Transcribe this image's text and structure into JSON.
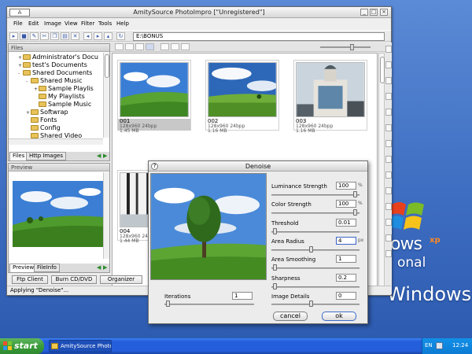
{
  "window": {
    "title": "AmitySource PhotoImpro [\"Unregistered\"]",
    "app_icon_label": "A",
    "controls": {
      "minimize": "_",
      "maximize": "□",
      "close": "×"
    }
  },
  "menu": [
    "File",
    "Edit",
    "Image",
    "View",
    "Filter",
    "Tools",
    "Help"
  ],
  "toolbar": {
    "path": "E:\\BONUS"
  },
  "files_panel": {
    "header": "Files",
    "tree": [
      {
        "label": "Administrator's Docu",
        "depth": 1,
        "expander": "+"
      },
      {
        "label": "test's Documents",
        "depth": 1,
        "expander": "+"
      },
      {
        "label": "Shared Documents",
        "depth": 1,
        "expander": "-"
      },
      {
        "label": "Shared Music",
        "depth": 2,
        "expander": "-"
      },
      {
        "label": "Sample Playlis",
        "depth": 3,
        "expander": "+"
      },
      {
        "label": "My Playlists",
        "depth": 3,
        "expander": ""
      },
      {
        "label": "Sample Music",
        "depth": 3,
        "expander": ""
      },
      {
        "label": "Softwrap",
        "depth": 2,
        "expander": "+"
      },
      {
        "label": "Fonts",
        "depth": 2,
        "expander": ""
      },
      {
        "label": "Config",
        "depth": 2,
        "expander": ""
      },
      {
        "label": "Shared Video",
        "depth": 2,
        "expander": ""
      }
    ],
    "tabs": [
      "Files",
      "Http Images"
    ]
  },
  "preview_panel": {
    "header": "Preview",
    "tabs": [
      "Preview",
      "FileInfo"
    ]
  },
  "thumbnails": [
    {
      "name": "001",
      "line1": "128x960 24bpp",
      "line2": "1.45 MB",
      "selected": true
    },
    {
      "name": "002",
      "line1": "128x960 24bpp",
      "line2": "1.16 MB",
      "selected": false
    },
    {
      "name": "003",
      "line1": "128x960 24bpp",
      "line2": "1.16 MB",
      "selected": false
    },
    {
      "name": "004",
      "line1": "128x960 24bpp",
      "line2": "1.44 MB",
      "selected": false
    }
  ],
  "bottom_buttons": [
    "Ftp Client",
    "Burn CD/DVD",
    "Organizer"
  ],
  "status": "Applying \"Denoise\"...",
  "dialog": {
    "title": "Denoise",
    "help": "?",
    "params": [
      {
        "label": "Luminance Strength",
        "value": "100",
        "unit": "%",
        "level": 0.97
      },
      {
        "label": "Color Strength",
        "value": "100",
        "unit": "%",
        "level": 0.97
      },
      {
        "label": "Threshold",
        "value": "0.01",
        "unit": "",
        "level": 0.02
      },
      {
        "label": "Area Radius",
        "value": "4",
        "unit": "px",
        "level": 0.45
      },
      {
        "label": "Area Smoothing",
        "value": "1",
        "unit": "",
        "level": 0.02
      },
      {
        "label": "Sharpness",
        "value": "0.2",
        "unit": "",
        "level": 0.02
      },
      {
        "label": "Image Details",
        "value": "0",
        "unit": "",
        "level": 0.45
      }
    ],
    "iterations": {
      "label": "Iterations",
      "value": "1",
      "level": 0.02
    },
    "cancel_label": "cancel",
    "ok_label": "ok"
  },
  "desktop": {
    "brand_text": "Windows",
    "brand_visible": "ows",
    "brand_sup": "xp",
    "brand_line2": "onal"
  },
  "taskbar": {
    "start_label": "start",
    "task_label": "AmitySource PhotoIm...",
    "lang": "EN",
    "clock": "12:24"
  },
  "colors": {
    "taskbar": "#245edb",
    "start": "#3a9c3a",
    "accent": "#3b64c8"
  }
}
